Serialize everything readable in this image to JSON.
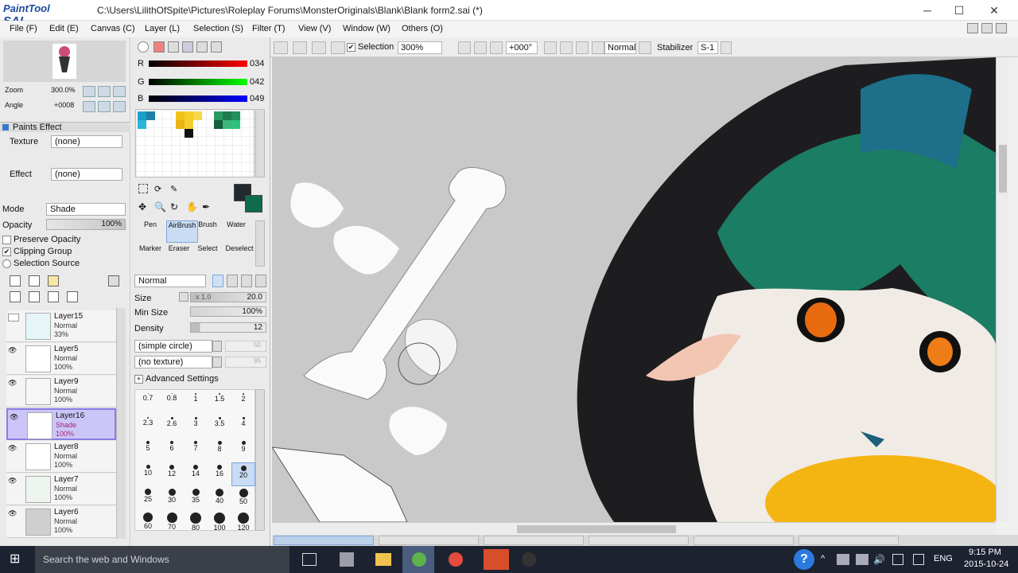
{
  "app": {
    "name": "PaintTool SAI",
    "logo_text": "PaintTool SAI",
    "title": "C:\\Users\\LilithOfSpite\\Pictures\\Roleplay Forums\\MonsterOriginals\\Blank\\Blank form2.sai (*)"
  },
  "window": {
    "minimize": "─",
    "maximize": "☐",
    "close": "✕"
  },
  "menu": [
    "File (F)",
    "Edit (E)",
    "Canvas (C)",
    "Layer (L)",
    "Selection (S)",
    "Filter (T)",
    "View (V)",
    "Window (W)",
    "Others (O)"
  ],
  "toolbar": {
    "selection_label": "Selection",
    "zoom": "300%",
    "angle": "+000°",
    "blend": "Normal",
    "stabilizer_label": "Stabilizer",
    "stabilizer_value": "S-1"
  },
  "navigator": {
    "zoom_label": "Zoom",
    "zoom_value": "300.0%",
    "angle_label": "Angle",
    "angle_value": "+0008"
  },
  "paints_effect": {
    "header": "Paints Effect",
    "texture_label": "Texture",
    "texture_value": "(none)",
    "effect_label": "Effect",
    "effect_value": "(none)"
  },
  "layer_props": {
    "mode_label": "Mode",
    "mode_value": "Shade",
    "opacity_label": "Opacity",
    "opacity_value": "100%",
    "preserve_opacity": "Preserve Opacity",
    "clipping_group": "Clipping Group",
    "selection_source": "Selection Source"
  },
  "layers": [
    {
      "name": "Layer15",
      "mode": "Normal",
      "opacity": "33%",
      "visible": false,
      "selected": false
    },
    {
      "name": "Layer5",
      "mode": "Normal",
      "opacity": "100%",
      "visible": true,
      "selected": false
    },
    {
      "name": "Layer9",
      "mode": "Normal",
      "opacity": "100%",
      "visible": true,
      "selected": false
    },
    {
      "name": "Layer16",
      "mode": "Shade",
      "opacity": "100%",
      "visible": true,
      "selected": true
    },
    {
      "name": "Layer8",
      "mode": "Normal",
      "opacity": "100%",
      "visible": true,
      "selected": false
    },
    {
      "name": "Layer7",
      "mode": "Normal",
      "opacity": "100%",
      "visible": true,
      "selected": false
    },
    {
      "name": "Layer6",
      "mode": "Normal",
      "opacity": "100%",
      "visible": true,
      "selected": false
    }
  ],
  "color": {
    "r_label": "R",
    "r_value": "034",
    "g_label": "G",
    "g_value": "042",
    "b_label": "B",
    "b_value": "049",
    "primary": "#22292f",
    "secondary": "#0f6b4a"
  },
  "tools": {
    "row1": [
      "Pen",
      "AirBrush",
      "Brush",
      "Water"
    ],
    "row2": [
      "Marker",
      "Eraser",
      "Select",
      "Deselect"
    ]
  },
  "brush": {
    "blend": "Normal",
    "size_label": "Size",
    "size_mult": "x 1.0",
    "size_value": "20.0",
    "min_size_label": "Min Size",
    "min_size_value": "100%",
    "density_label": "Density",
    "density_value": "12",
    "shape": "(simple circle)",
    "texture": "(no texture)",
    "shape_value": "50",
    "texture_value": "95",
    "advanced": "Advanced Settings"
  },
  "brush_sizes": [
    "0.7",
    "0.8",
    "1",
    "1.5",
    "2",
    "2.3",
    "2.6",
    "3",
    "3.5",
    "4",
    "5",
    "6",
    "7",
    "8",
    "9",
    "10",
    "12",
    "14",
    "16",
    "20",
    "25",
    "30",
    "35",
    "40",
    "50",
    "60",
    "70",
    "80",
    "100",
    "120"
  ],
  "taskbar": {
    "search": "Search the web and Windows",
    "time": "9:15 PM",
    "date": "2015-10-24",
    "lang": "ENG"
  }
}
